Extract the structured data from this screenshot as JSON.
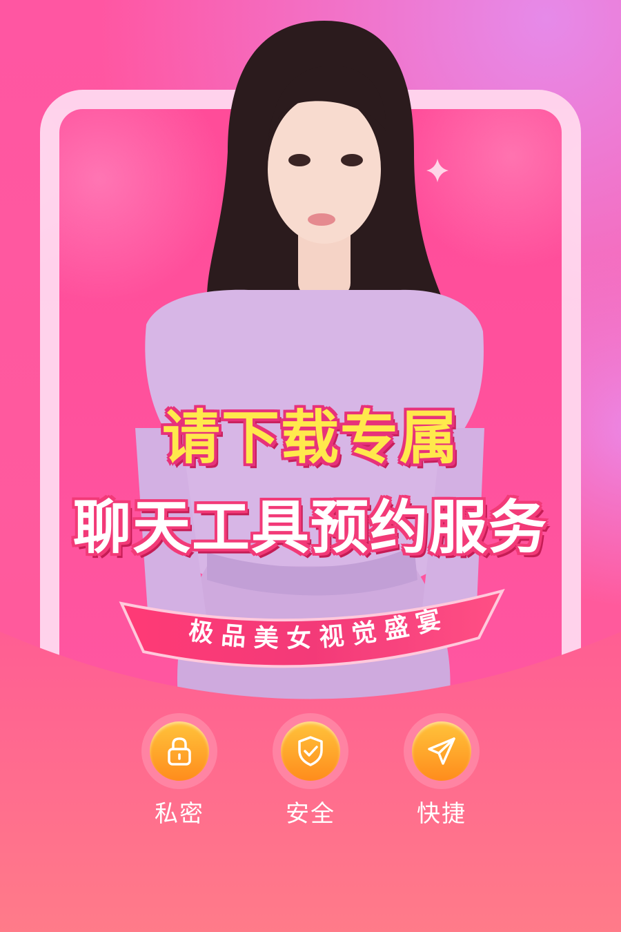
{
  "promo": {
    "headline_line1": "请下载专属",
    "headline_line2": "聊天工具预约服务",
    "ribbon_text": "极品美女视觉盛宴"
  },
  "features": [
    {
      "label": "私密",
      "icon": "lock-icon"
    },
    {
      "label": "安全",
      "icon": "shield-check-icon"
    },
    {
      "label": "快捷",
      "icon": "paper-plane-icon"
    }
  ],
  "colors": {
    "background_pink": "#ff56a2",
    "background_magenta": "#e68ae9",
    "bottom_section": "#ff6a92",
    "headline_yellow": "#ffe94c",
    "headline_outline": "#e7327a",
    "icon_orange_top": "#ffc43c",
    "icon_orange_bottom": "#ff8c1c"
  }
}
